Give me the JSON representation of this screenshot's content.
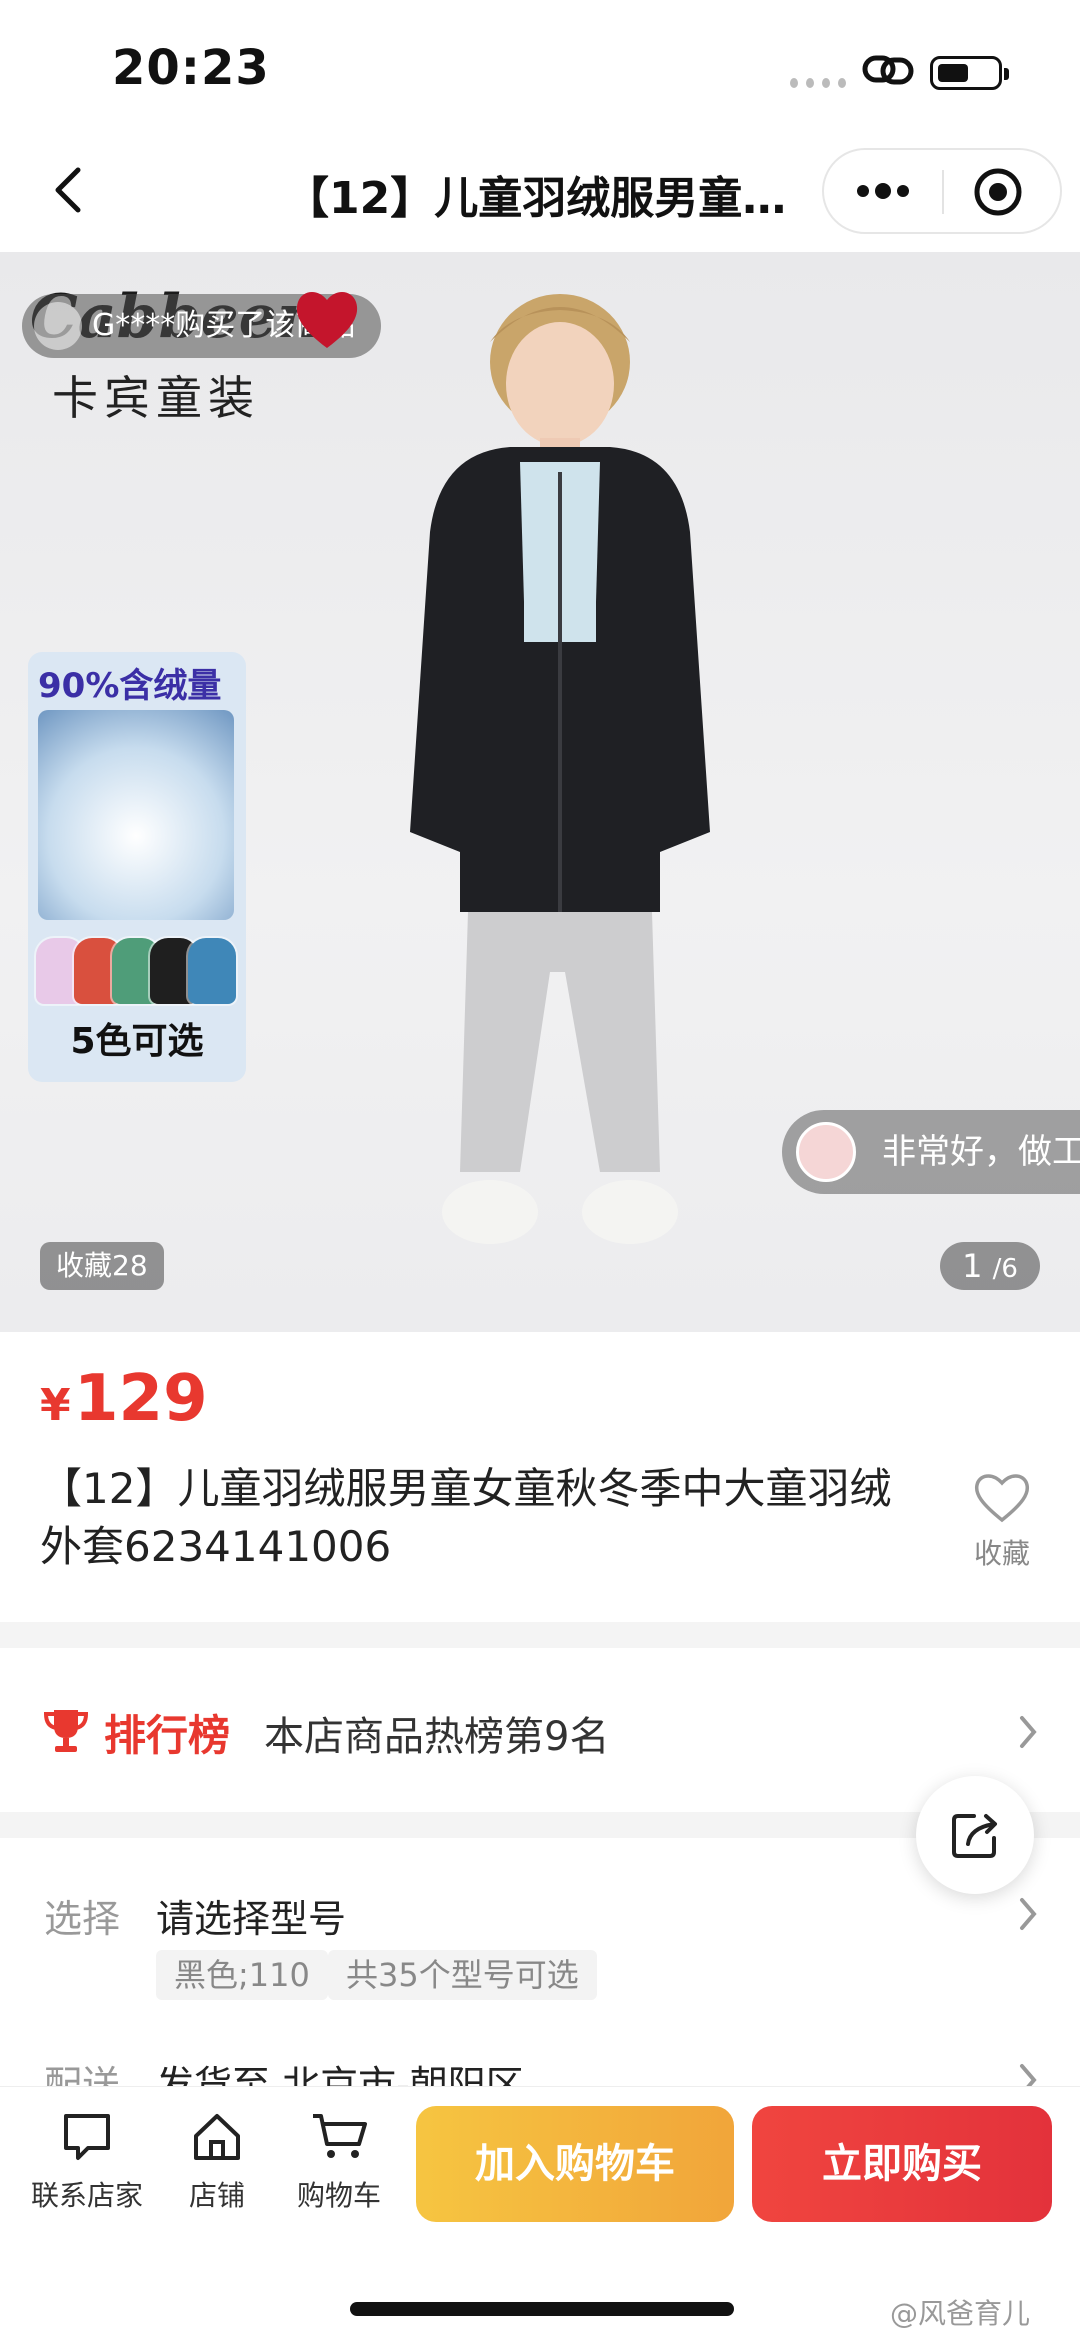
{
  "status": {
    "time": "20:23"
  },
  "nav": {
    "title": "【12】儿童羽绒服男童…"
  },
  "hero": {
    "brand_logo": "Cabbeen",
    "brand_name": "卡宾童装",
    "toast": "G****购买了该商品",
    "promo_top": "90%含绒量",
    "promo_bottom": "5色可选",
    "favorite_badge": "收藏28",
    "page_current": "1",
    "page_total": "/6",
    "review": "非常好，做工",
    "jacket_colors": [
      "#e8c9e8",
      "#d9503e",
      "#4f9d79",
      "#1f1f1f",
      "#3f87b8"
    ]
  },
  "product": {
    "currency": "¥",
    "price": "129",
    "title": "【12】儿童羽绒服男童女童秋冬季中大童羽绒外套6234141006",
    "favorite_label": "收藏"
  },
  "ranking": {
    "label": "排行榜",
    "text": "本店商品热榜第9名"
  },
  "selection": {
    "key": "选择",
    "value": "请选择型号",
    "tags": [
      "黑色;110",
      "共35个型号可选"
    ]
  },
  "shipping": {
    "key": "配送",
    "value": "发货至 北京市-朝阳区"
  },
  "bottom": {
    "tabs": [
      "联系店家",
      "店铺",
      "购物车"
    ],
    "add_cart": "加入购物车",
    "buy_now": "立即购买"
  },
  "watermark": "@风爸育儿",
  "colors": {
    "accent_red": "#e8382f",
    "cart_yellow": "#f6c541",
    "buy_red": "#e3323b"
  }
}
